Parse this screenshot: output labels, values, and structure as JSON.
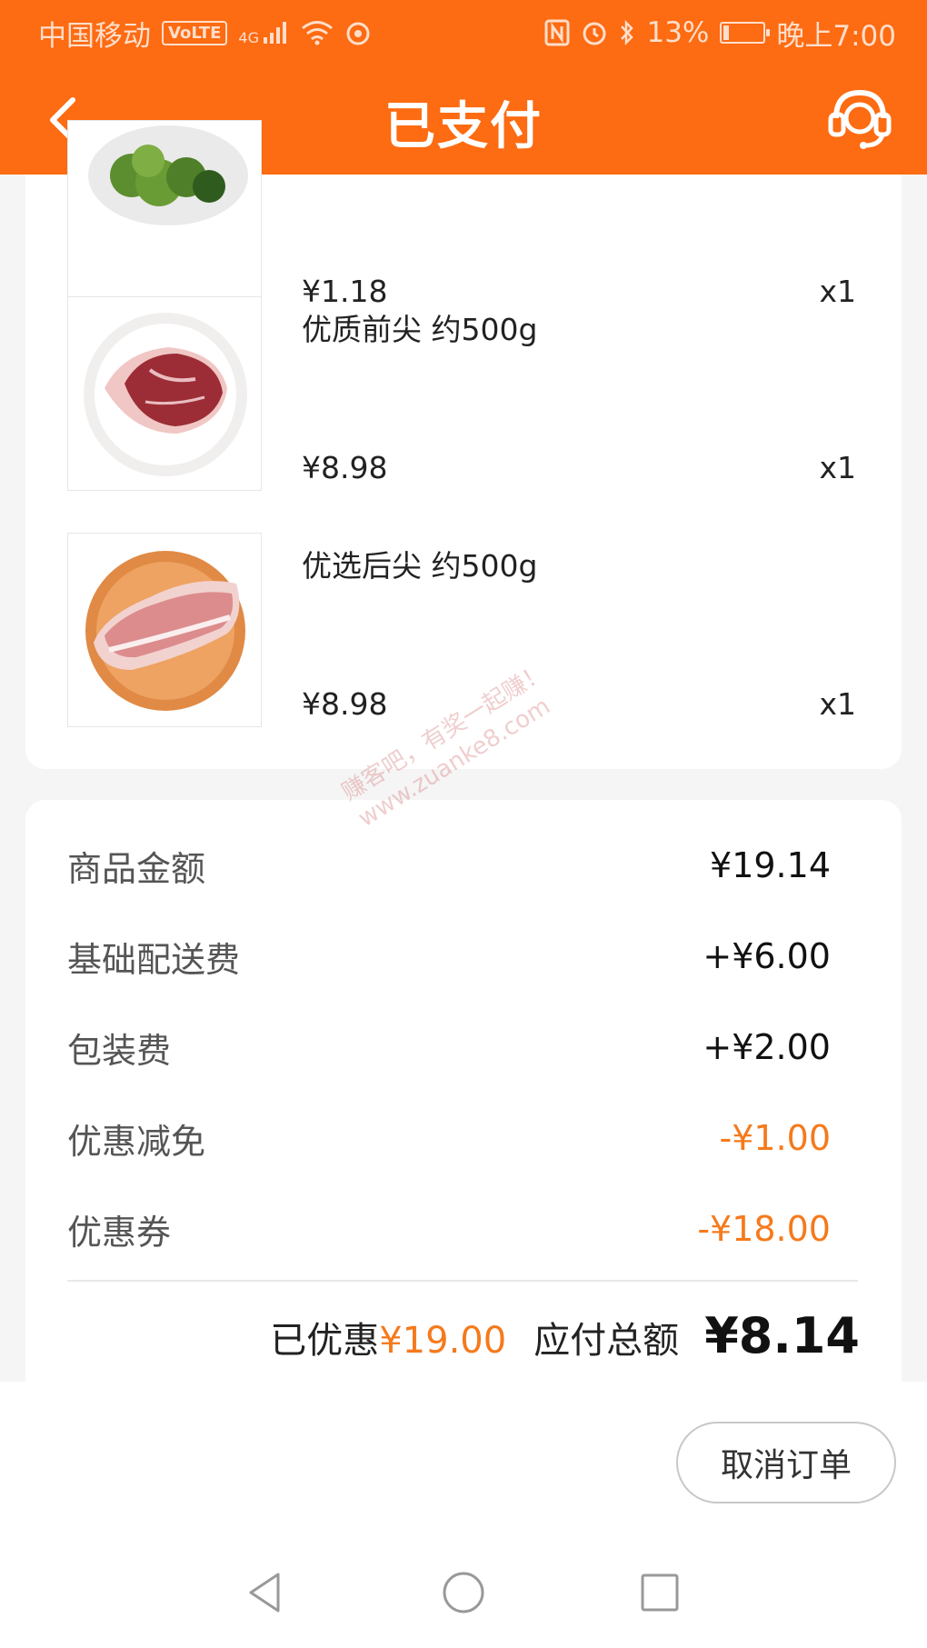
{
  "status_bar": {
    "carrier": "中国移动",
    "volte": "VoLTE",
    "network": "4G",
    "nfc": "N",
    "battery_percent": "13%",
    "battery_level": 0.13,
    "time": "晚上7:00"
  },
  "header": {
    "title": "已支付",
    "background_color": "#fd6b12"
  },
  "products": [
    {
      "name": "",
      "price": "¥1.18",
      "qty": "x1",
      "image": "broccoli-image"
    },
    {
      "name": "优质前尖 约500g",
      "price": "¥8.98",
      "qty": "x1",
      "image": "pork-front-image"
    },
    {
      "name": "优选后尖 约500g",
      "price": "¥8.98",
      "qty": "x1",
      "image": "pork-rear-image"
    }
  ],
  "summary": {
    "rows": [
      {
        "label": "商品金额",
        "value": "¥19.14"
      },
      {
        "label": "基础配送费",
        "value": "+¥6.00"
      },
      {
        "label": "包装费",
        "value": "+¥2.00"
      },
      {
        "label": "优惠减免",
        "value": "-¥1.00"
      },
      {
        "label": "优惠券",
        "value": "-¥18.00"
      }
    ],
    "saved_label": "已优惠",
    "saved_amount": "¥19.00",
    "total_label": "应付总额",
    "total_amount": "¥8.14",
    "discount_color": "#f57a1c"
  },
  "actions": {
    "cancel_label": "取消订单"
  },
  "watermark": {
    "line1": "赚客吧，有奖一起赚！",
    "line2": "www.zuanke8.com"
  }
}
